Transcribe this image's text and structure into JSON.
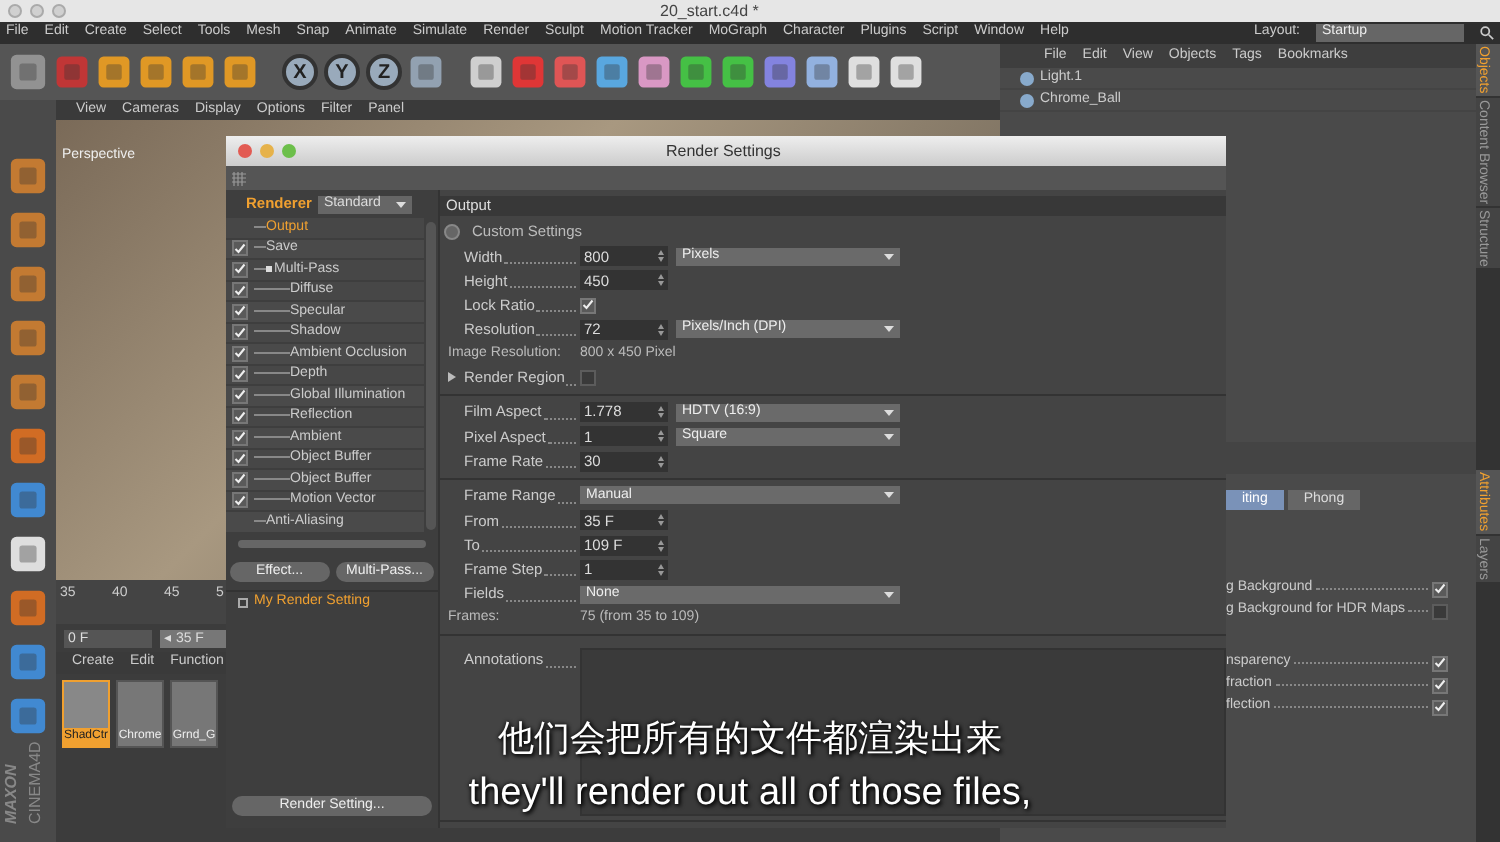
{
  "window": {
    "title": "20_start.c4d *"
  },
  "menu": [
    "File",
    "Edit",
    "Create",
    "Select",
    "Tools",
    "Mesh",
    "Snap",
    "Animate",
    "Simulate",
    "Render",
    "Sculpt",
    "Motion Tracker",
    "MoGraph",
    "Character",
    "Plugins",
    "Script",
    "Window",
    "Help"
  ],
  "layout": {
    "label": "Layout:",
    "value": "Startup"
  },
  "toolbar": {
    "axes": [
      "X",
      "Y",
      "Z"
    ]
  },
  "viewport": {
    "menu": [
      "View",
      "Cameras",
      "Display",
      "Options",
      "Filter",
      "Panel"
    ],
    "label": "Perspective"
  },
  "timeline": {
    "ticks": [
      "35",
      "40",
      "45",
      "5"
    ],
    "frame_field": "0 F",
    "current_frame": "◂ 35 F"
  },
  "materials": {
    "menu": [
      "Create",
      "Edit",
      "Function"
    ],
    "items": [
      {
        "name": "ShadCtr",
        "selected": true
      },
      {
        "name": "Chrome",
        "selected": false
      },
      {
        "name": "Grnd_G",
        "selected": false
      }
    ]
  },
  "logo": {
    "brand": "MAXON",
    "product": "CINEMA4D"
  },
  "object_manager": {
    "menu": [
      "File",
      "Edit",
      "View",
      "Objects",
      "Tags",
      "Bookmarks"
    ],
    "objects": [
      {
        "name": "Light.1"
      },
      {
        "name": "Chrome_Ball"
      }
    ]
  },
  "side_tabs_top": [
    {
      "label": "Objects",
      "selected": true
    },
    {
      "label": "Content Browser",
      "selected": false
    },
    {
      "label": "Structure",
      "selected": false
    }
  ],
  "side_tabs_bottom": [
    {
      "label": "Attributes",
      "selected": true
    },
    {
      "label": "Layers",
      "selected": false
    }
  ],
  "attributes": {
    "tabs": [
      {
        "label": "iting",
        "selected": true
      },
      {
        "label": "Phong",
        "selected": false
      }
    ],
    "rows": [
      {
        "label": "g Background",
        "checked": true
      },
      {
        "label": "g Background for HDR Maps",
        "checked": false
      },
      {
        "label": "nsparency",
        "checked": true
      },
      {
        "label": "fraction",
        "checked": true
      },
      {
        "label": "flection",
        "checked": true
      }
    ]
  },
  "dialog": {
    "title": "Render Settings",
    "renderer_label": "Renderer",
    "renderer": "Standard",
    "tree": [
      {
        "label": "Output",
        "selected": true
      },
      {
        "label": "Save",
        "checked": true,
        "selected": false
      },
      {
        "label": "Multi-Pass",
        "checked": true,
        "selected": false,
        "expanded": true,
        "children": [
          {
            "label": "Diffuse",
            "checked": true,
            "selected": false
          },
          {
            "label": "Specular",
            "checked": true,
            "selected": false
          },
          {
            "label": "Shadow",
            "checked": true,
            "selected": false
          },
          {
            "label": "Ambient Occlusion",
            "checked": true,
            "selected": false
          },
          {
            "label": "Depth",
            "checked": true,
            "selected": false
          },
          {
            "label": "Global Illumination",
            "checked": true,
            "selected": false
          },
          {
            "label": "Reflection",
            "checked": true,
            "selected": false
          },
          {
            "label": "Ambient",
            "checked": true,
            "selected": false
          },
          {
            "label": "Object Buffer",
            "checked": true,
            "selected": false
          },
          {
            "label": "Object Buffer",
            "checked": true,
            "selected": false
          },
          {
            "label": "Motion Vector",
            "checked": true,
            "selected": false
          }
        ]
      },
      {
        "label": "Anti-Aliasing",
        "selected": false
      }
    ],
    "buttons": [
      "Effect...",
      "Multi-Pass..."
    ],
    "settings": [
      {
        "label": "My Render Setting",
        "selected": true
      }
    ],
    "bottom_button": "Render Setting...",
    "header": "Output",
    "sections": [
      [
        {
          "kind": "preset",
          "label": "Custom Settings"
        },
        {
          "kind": "field",
          "label": "Width",
          "value": "800",
          "unit": "Pixels"
        },
        {
          "kind": "field",
          "label": "Height",
          "value": "450"
        },
        {
          "kind": "check",
          "label": "Lock Ratio",
          "checked": true
        },
        {
          "kind": "field",
          "label": "Resolution",
          "value": "72",
          "unit": "Pixels/Inch (DPI)"
        },
        {
          "kind": "info",
          "label": "Image Resolution:",
          "value": "800 x 450 Pixel"
        },
        {
          "kind": "expander",
          "label": "Render Region",
          "checked": false
        }
      ],
      [
        {
          "kind": "field",
          "label": "Film Aspect",
          "value": "1.778",
          "unit": "HDTV (16:9)"
        },
        {
          "kind": "field",
          "label": "Pixel Aspect",
          "value": "1",
          "unit": "Square"
        },
        {
          "kind": "field",
          "label": "Frame Rate",
          "value": "30"
        }
      ],
      [
        {
          "kind": "dropdown",
          "label": "Frame Range",
          "value": "Manual"
        },
        {
          "kind": "field",
          "label": "From",
          "value": "35 F"
        },
        {
          "kind": "field",
          "label": "To",
          "value": "109 F"
        },
        {
          "kind": "field",
          "label": "Frame Step",
          "value": "1"
        },
        {
          "kind": "dropdown",
          "label": "Fields",
          "value": "None"
        },
        {
          "kind": "info",
          "label": "Frames:",
          "value": "75 (from 35 to 109)"
        }
      ],
      [
        {
          "kind": "textarea",
          "label": "Annotations"
        }
      ]
    ]
  },
  "subtitles": {
    "zh": "他们会把所有的文件都渲染出来",
    "en": "they'll render out all of those files,"
  }
}
